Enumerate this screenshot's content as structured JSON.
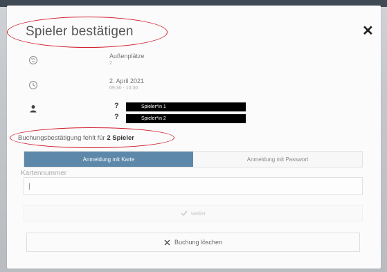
{
  "dialog": {
    "title": "Spieler bestätigen",
    "close_symbol": "✕"
  },
  "location": {
    "icon": "globe-icon",
    "name": "Außenplätze",
    "court": "2"
  },
  "time": {
    "icon": "clock-icon",
    "date": "2. April 2021",
    "range": "09:30 - 10:30"
  },
  "players": {
    "icon": "person-icon",
    "items": [
      {
        "status": "?",
        "label": "Spieler*in 1"
      },
      {
        "status": "?",
        "label": "Spieler*in 2"
      }
    ]
  },
  "pending": {
    "prefix": "Buchungsbestätigung fehlt für ",
    "count": "2 Spieler"
  },
  "tabs": [
    {
      "label": "Anmeldung mit Karte",
      "active": true
    },
    {
      "label": "Anmeldung mit Passwort",
      "active": false
    }
  ],
  "card_field": {
    "label": "Kartennummer",
    "value": "",
    "placeholder": "|"
  },
  "buttons": {
    "weiter": "weiter",
    "weiter_icon": "check-icon",
    "delete": "Buchung löschen",
    "delete_icon": "close-icon"
  },
  "colors": {
    "accent_tab": "#5d88a9",
    "annotation_red": "#d11a2a"
  }
}
